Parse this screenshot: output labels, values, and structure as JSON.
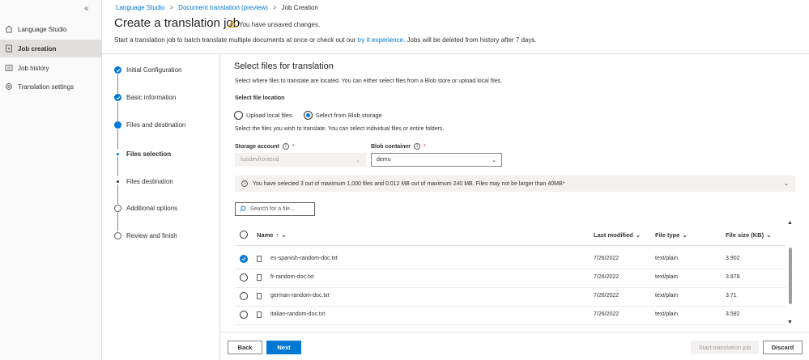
{
  "nav": {
    "collapse_icon": "double-chevron-left-icon",
    "items": [
      {
        "label": "Language Studio",
        "icon": "home-icon"
      },
      {
        "label": "Job creation",
        "icon": "document-add-icon",
        "active": true
      },
      {
        "label": "Job history",
        "icon": "list-icon"
      },
      {
        "label": "Translation settings",
        "icon": "gear-icon"
      }
    ]
  },
  "breadcrumb": {
    "items": [
      "Language Studio",
      "Document translation (preview)",
      "Job Creation"
    ],
    "separator": ">"
  },
  "header": {
    "title": "Create a translation job",
    "unsaved": "You have unsaved changes.",
    "intro_pre": "Start a translation job to batch translate multiple documents at once or check out our ",
    "intro_link": "try it experience",
    "intro_post": ". Jobs will be deleted from history after 7 days."
  },
  "steps": [
    {
      "label": "Initial Configuration",
      "state": "done"
    },
    {
      "label": "Basic information",
      "state": "done"
    },
    {
      "label": "Files and destination",
      "state": "current"
    },
    {
      "label": "Files selection",
      "state": "sub-current"
    },
    {
      "label": "Files destination",
      "state": "sub"
    },
    {
      "label": "Additional options",
      "state": "todo"
    },
    {
      "label": "Review and finish",
      "state": "todo"
    }
  ],
  "main": {
    "title": "Select files for translation",
    "desc": "Select where files to translate are located. You can either select files from a Blob store or upload local files.",
    "location_label": "Select file location",
    "options": [
      "Upload local files",
      "Select from Blob storage"
    ],
    "selected_option": 1,
    "sub_desc": "Select the files you wish to translate. You can select individual files or entire folders.",
    "storage_label": "Storage account",
    "storage_value": "luisdevfrontend",
    "container_label": "Blob container",
    "container_value": "demo",
    "required_mark": "*",
    "info_text": "You have selected 3 out of maximum 1,000 files and 0.012 MB out of maximum 240 MB. Files may not be larger than 40MB*",
    "search_placeholder": "Search for a file..."
  },
  "table": {
    "columns": [
      "Name",
      "Last modified",
      "File type",
      "File size (KB)"
    ],
    "sort_indicator": "↑",
    "rows": [
      {
        "name": "es-spanish-random-doc.txt",
        "modified": "7/26/2022",
        "type": "text/plain",
        "size": "3.902",
        "checked": true
      },
      {
        "name": "fr-random-doc.txt",
        "modified": "7/26/2022",
        "type": "text/plain",
        "size": "3.878",
        "checked": false
      },
      {
        "name": "german-random-doc.txt",
        "modified": "7/26/2022",
        "type": "text/plain",
        "size": "3.71",
        "checked": false
      },
      {
        "name": "italian-random-doc.txt",
        "modified": "7/26/2022",
        "type": "text/plain",
        "size": "3.592",
        "checked": false
      }
    ]
  },
  "footer": {
    "back": "Back",
    "next": "Next",
    "start": "Start translation job",
    "discard": "Discard"
  },
  "colors": {
    "accent": "#0078d4",
    "warning": "#d29200"
  }
}
